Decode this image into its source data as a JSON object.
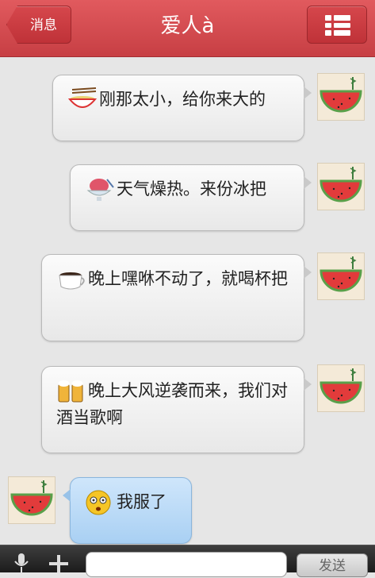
{
  "header": {
    "back_label": "消息",
    "title": "爱人à",
    "menu_icon": "list-menu-icon"
  },
  "messages": [
    {
      "sender": "me",
      "emoji": "noodle-bowl-icon",
      "text": "刚那太小，给你来大的"
    },
    {
      "sender": "me",
      "emoji": "shaved-ice-icon",
      "text": "天气燥热。来份冰把"
    },
    {
      "sender": "me",
      "emoji": "coffee-cup-icon",
      "text": "晚上嘿咻不动了，就喝杯把"
    },
    {
      "sender": "me",
      "emoji": "beer-mugs-icon",
      "text": "晚上大风逆袭而来，我们对酒当歌啊"
    },
    {
      "sender": "other",
      "emoji": "dizzy-face-icon",
      "text": "我服了"
    }
  ],
  "input_bar": {
    "send_label": "发送",
    "voice_icon": "microphone-icon",
    "plus_icon": "plus-icon"
  },
  "avatars": {
    "me": "watermelon-avatar",
    "other": "watermelon-avatar"
  },
  "colors": {
    "header": "#d24d52",
    "background": "#e6e6e6",
    "my_bubble": "#f2f2f2",
    "their_bubble": "#b8d8f5"
  }
}
